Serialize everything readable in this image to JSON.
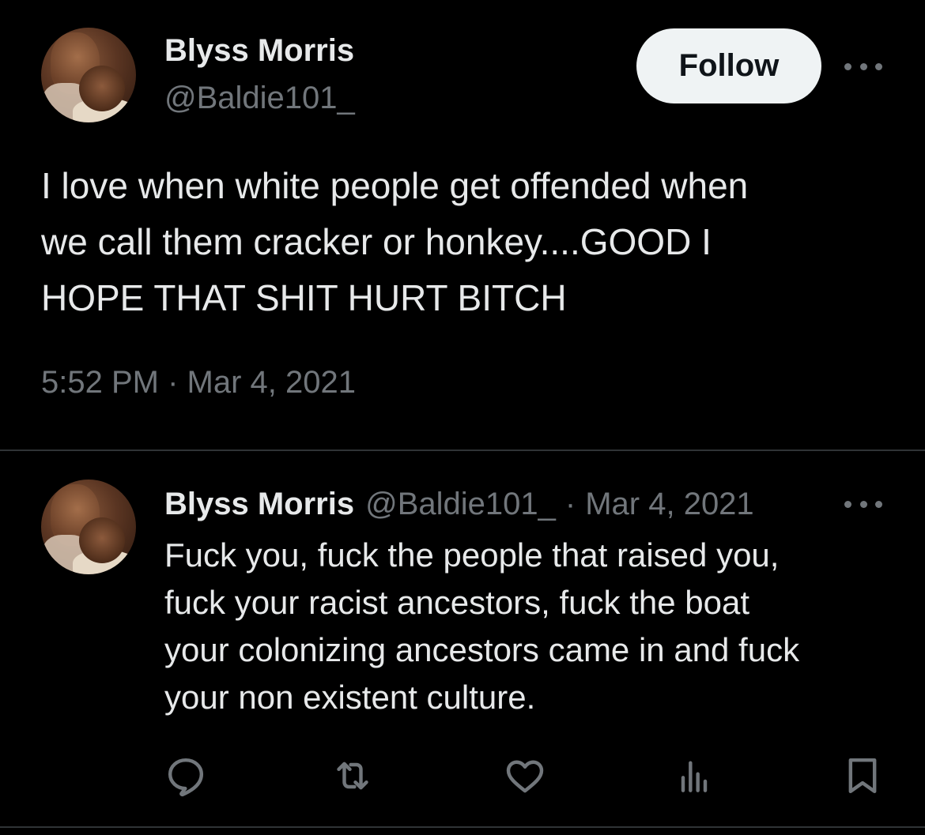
{
  "main_tweet": {
    "author": {
      "display_name": "Blyss Morris",
      "handle": "@Baldie101_"
    },
    "follow_label": "Follow",
    "text_lines": [
      "I love when white people get offended when",
      "we call them cracker or honkey....GOOD I",
      "HOPE THAT SHIT HURT BITCH"
    ],
    "timestamp": "5:52 PM · Mar 4, 2021"
  },
  "reply": {
    "author": {
      "display_name": "Blyss Morris",
      "handle": "@Baldie101_"
    },
    "separator": "·",
    "date": "Mar 4, 2021",
    "text_lines": [
      "Fuck you, fuck the people that raised you,",
      "fuck your racist ancestors, fuck the boat",
      "your colonizing ancestors came in and fuck",
      "your non existent culture."
    ],
    "actions": [
      {
        "icon": "reply-icon"
      },
      {
        "icon": "retweet-icon"
      },
      {
        "icon": "like-icon"
      },
      {
        "icon": "views-icon"
      },
      {
        "icon": "bookmark-icon"
      }
    ]
  },
  "colors": {
    "background": "#000000",
    "primary_text": "#e7e9ea",
    "secondary_text": "#71767b",
    "divider": "#2f3336",
    "follow_button_bg": "#eff3f4",
    "follow_button_text": "#0f1419"
  }
}
